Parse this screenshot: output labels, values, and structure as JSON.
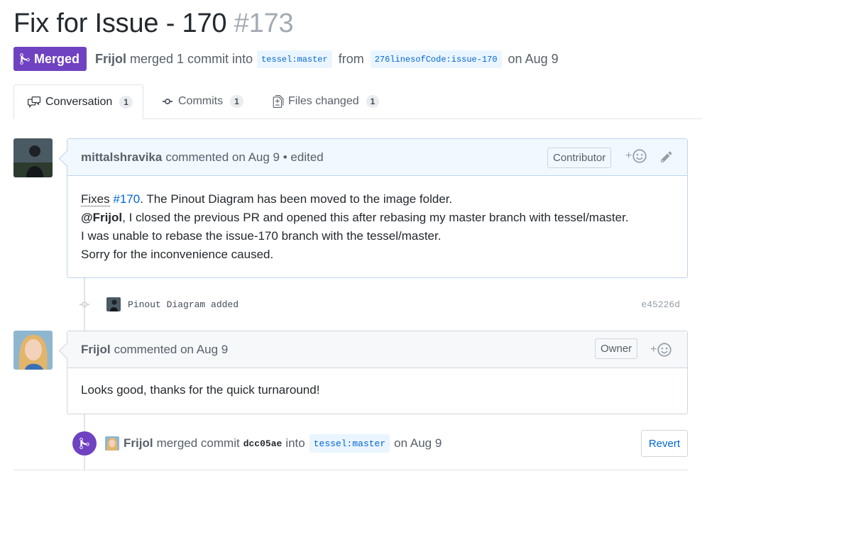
{
  "pr": {
    "title": "Fix for Issue - 170",
    "number": "#173",
    "state": "Merged",
    "author": "Frijol",
    "merged_text": "merged 1 commit into",
    "base_ref": "tessel:master",
    "from_text": "from",
    "head_ref": "276linesofCode:issue-170",
    "date_text": "on Aug 9"
  },
  "tabs": [
    {
      "label": "Conversation",
      "count": "1",
      "icon": "comment-discussion-icon",
      "selected": true
    },
    {
      "label": "Commits",
      "count": "1",
      "icon": "git-commit-icon",
      "selected": false
    },
    {
      "label": "Files changed",
      "count": "1",
      "icon": "file-diff-icon",
      "selected": false
    }
  ],
  "comment1": {
    "author": "mittalshravika",
    "meta": "commented on Aug 9 • edited",
    "role": "Contributor",
    "react": "+",
    "line1_keyword": "Fixes",
    "line1_link": "#170",
    "line1_rest": ". The Pinout Diagram has been moved to the image folder.",
    "line2_mention": "@Frijol",
    "line2_rest": ", I closed the previous PR and opened this after rebasing my master branch with tessel/master.",
    "line3": "I was unable to rebase the issue-170 branch with the tessel/master.",
    "line4": "Sorry for the inconvenience caused."
  },
  "commit": {
    "message": "Pinout Diagram added",
    "sha": "e45226d"
  },
  "comment2": {
    "author": "Frijol",
    "meta": "commented on Aug 9",
    "role": "Owner",
    "react": "+",
    "body": "Looks good, thanks for the quick turnaround!"
  },
  "merge_event": {
    "author": "Frijol",
    "text1": "merged commit",
    "sha": "dcc05ae",
    "text2": "into",
    "ref": "tessel:master",
    "date": "on Aug 9",
    "revert_label": "Revert"
  },
  "colors": {
    "merged_purple": "#6f42c1",
    "link_blue": "#0366d6",
    "header_blue_bg": "#f1f8ff"
  }
}
